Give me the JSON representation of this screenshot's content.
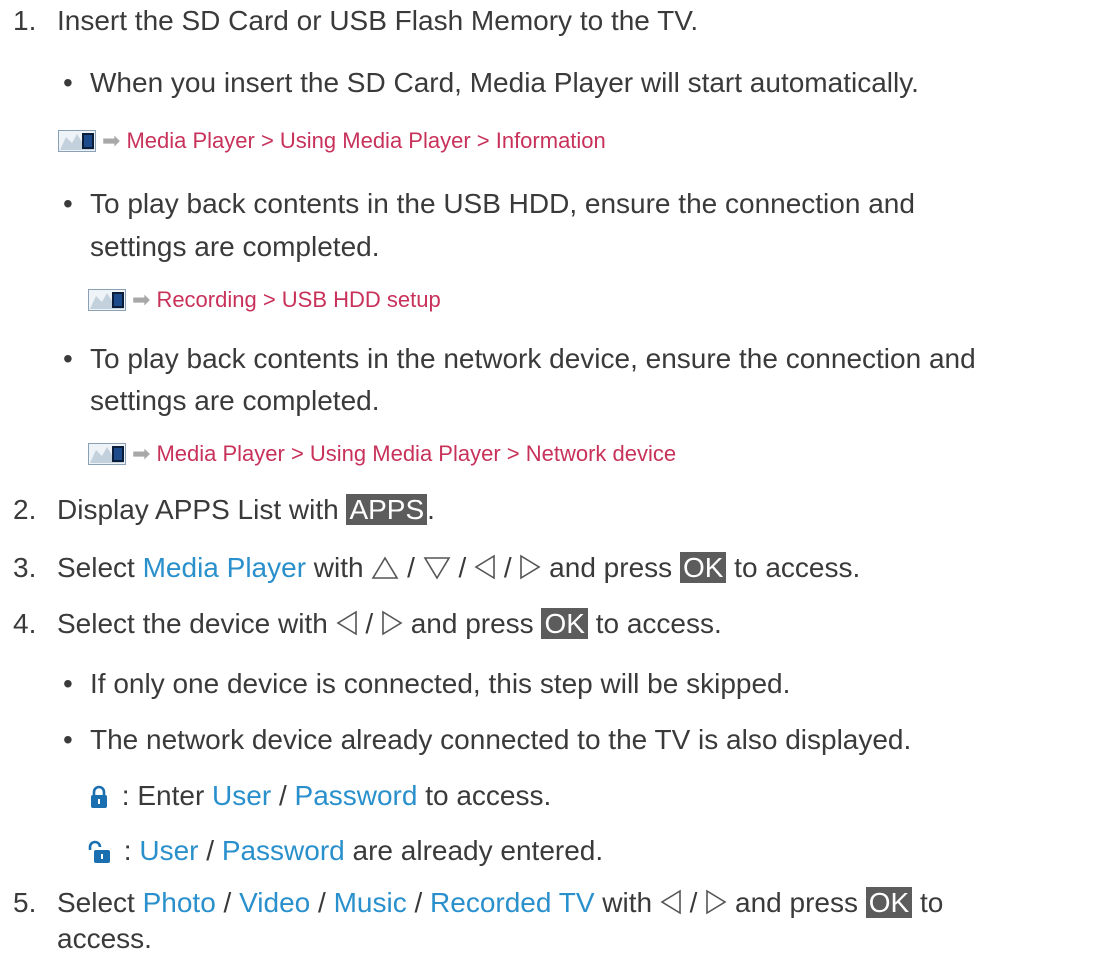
{
  "step1": {
    "number": "1.",
    "text": "Insert the SD Card or USB Flash Memory to the TV.",
    "bullet1": "When you insert the SD Card, Media Player will start automatically.",
    "ref1": "Media Player > Using Media Player > Information",
    "bullet2_line1": "To play back contents in the USB HDD, ensure the connection and",
    "bullet2_line2": "settings are completed.",
    "ref2": "Recording > USB HDD setup",
    "bullet3_line1": "To play back contents in the network device, ensure the connection and",
    "bullet3_line2": "settings are completed.",
    "ref3": "Media Player > Using Media Player > Network device"
  },
  "step2": {
    "number": "2.",
    "text": "Display APPS List with ",
    "key": "APPS",
    "after": "."
  },
  "step3": {
    "number": "3.",
    "pre": "Select ",
    "link": "Media Player",
    "mid": " with ",
    "sep": " / ",
    "post": " and press ",
    "key": "OK",
    "end": " to access."
  },
  "step4": {
    "number": "4.",
    "pre": "Select the device with ",
    "sep": " / ",
    "post": " and press ",
    "key": "OK",
    "end": " to access.",
    "bullet1": "If only one device is connected, this step will be skipped.",
    "bullet2": "The network device already connected to the TV is also displayed.",
    "locked": {
      "pre": " : Enter ",
      "user": "User",
      "sep": " / ",
      "password": "Password",
      "post": " to access."
    },
    "unlocked": {
      "pre": " : ",
      "user": "User",
      "sep": " / ",
      "password": "Password",
      "post": " are already entered."
    }
  },
  "step5": {
    "number": "5.",
    "pre": "Select ",
    "photo": "Photo",
    "sep": " / ",
    "video": "Video",
    "music": "Music",
    "recorded": "Recorded TV",
    "mid": " with ",
    "post": " and press ",
    "key": "OK",
    "end": " to",
    "line2": "access."
  },
  "bullet_char": "•",
  "ref_arrow": "➡",
  "icons": [
    "tv-menu-icon",
    "up-arrow-icon",
    "down-arrow-icon",
    "left-arrow-icon",
    "right-arrow-icon",
    "lock-closed-icon",
    "lock-open-icon"
  ],
  "colors": {
    "link_pink": "#c8325a",
    "link_blue": "#2a90cc",
    "key_bg": "#5c5c5c"
  }
}
